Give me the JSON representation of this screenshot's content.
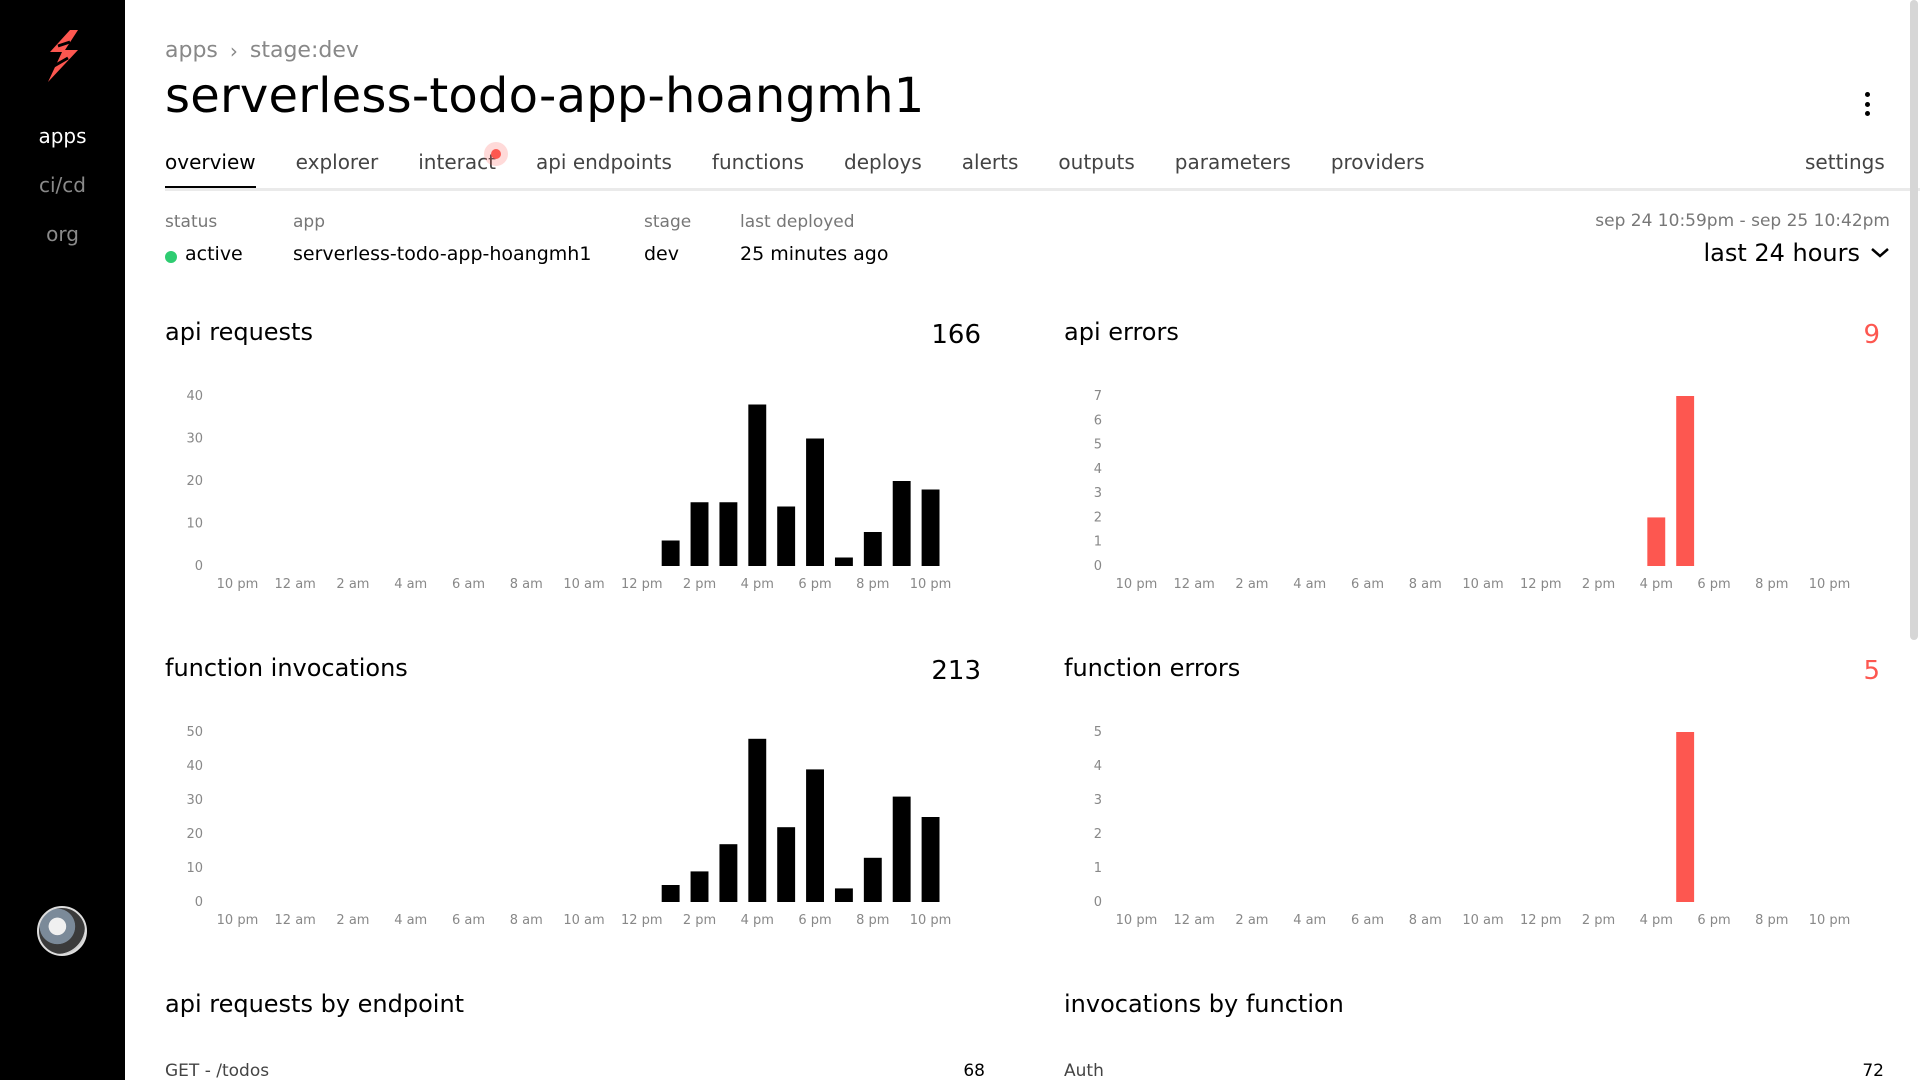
{
  "rail": {
    "items": [
      {
        "label": "apps",
        "active": true
      },
      {
        "label": "ci/cd",
        "active": false
      },
      {
        "label": "org",
        "active": false
      }
    ]
  },
  "breadcrumb": {
    "root": "apps",
    "current": "stage:dev"
  },
  "title": "serverless-todo-app-hoangmh1",
  "tabs": [
    {
      "label": "overview",
      "active": true
    },
    {
      "label": "explorer"
    },
    {
      "label": "interact",
      "notification": true
    },
    {
      "label": "api endpoints"
    },
    {
      "label": "functions"
    },
    {
      "label": "deploys"
    },
    {
      "label": "alerts"
    },
    {
      "label": "outputs"
    },
    {
      "label": "parameters"
    },
    {
      "label": "providers"
    }
  ],
  "settings_label": "settings",
  "meta": {
    "status_label": "status",
    "status_value": "active",
    "app_label": "app",
    "app_value": "serverless-todo-app-hoangmh1",
    "stage_label": "stage",
    "stage_value": "dev",
    "deployed_label": "last deployed",
    "deployed_value": "25 minutes ago"
  },
  "range": {
    "dates": "sep 24 10:59pm - sep 25 10:42pm",
    "selected": "last 24 hours"
  },
  "colors": {
    "black_bar": "#000000",
    "error_bar": "#fd5750",
    "active_dot": "#2ecc71"
  },
  "chart_data": [
    {
      "type": "bar",
      "title": "api requests",
      "total": "166",
      "categories": [
        "10 pm",
        "11 pm",
        "12 am",
        "1 am",
        "2 am",
        "3 am",
        "4 am",
        "5 am",
        "6 am",
        "7 am",
        "8 am",
        "9 am",
        "10 am",
        "11 am",
        "12 pm",
        "1 pm",
        "2 pm",
        "3 pm",
        "4 pm",
        "5 pm",
        "6 pm",
        "7 pm",
        "8 pm",
        "9 pm",
        "10 pm"
      ],
      "values": [
        0,
        0,
        0,
        0,
        0,
        0,
        0,
        0,
        0,
        0,
        0,
        0,
        0,
        0,
        0,
        6,
        15,
        15,
        38,
        14,
        30,
        2,
        8,
        20,
        18
      ],
      "ylim": [
        0,
        40
      ],
      "yticks": [
        0,
        10,
        20,
        30,
        40
      ],
      "xticks": [
        "10 pm",
        "12 am",
        "2 am",
        "4 am",
        "6 am",
        "8 am",
        "10 am",
        "12 pm",
        "2 pm",
        "4 pm",
        "6 pm",
        "8 pm",
        "10 pm"
      ],
      "color": "#000000"
    },
    {
      "type": "bar",
      "title": "api errors",
      "total": "9",
      "categories": [
        "10 pm",
        "11 pm",
        "12 am",
        "1 am",
        "2 am",
        "3 am",
        "4 am",
        "5 am",
        "6 am",
        "7 am",
        "8 am",
        "9 am",
        "10 am",
        "11 am",
        "12 pm",
        "1 pm",
        "2 pm",
        "3 pm",
        "4 pm",
        "5 pm",
        "6 pm",
        "7 pm",
        "8 pm",
        "9 pm",
        "10 pm"
      ],
      "values": [
        0,
        0,
        0,
        0,
        0,
        0,
        0,
        0,
        0,
        0,
        0,
        0,
        0,
        0,
        0,
        0,
        0,
        0,
        2,
        7,
        0,
        0,
        0,
        0,
        0
      ],
      "ylim": [
        0,
        7
      ],
      "yticks": [
        0,
        1,
        2,
        3,
        4,
        5,
        6,
        7
      ],
      "xticks": [
        "10 pm",
        "12 am",
        "2 am",
        "4 am",
        "6 am",
        "8 am",
        "10 am",
        "12 pm",
        "2 pm",
        "4 pm",
        "6 pm",
        "8 pm",
        "10 pm"
      ],
      "color": "#fd5750"
    },
    {
      "type": "bar",
      "title": "function invocations",
      "total": "213",
      "categories": [
        "10 pm",
        "11 pm",
        "12 am",
        "1 am",
        "2 am",
        "3 am",
        "4 am",
        "5 am",
        "6 am",
        "7 am",
        "8 am",
        "9 am",
        "10 am",
        "11 am",
        "12 pm",
        "1 pm",
        "2 pm",
        "3 pm",
        "4 pm",
        "5 pm",
        "6 pm",
        "7 pm",
        "8 pm",
        "9 pm",
        "10 pm"
      ],
      "values": [
        0,
        0,
        0,
        0,
        0,
        0,
        0,
        0,
        0,
        0,
        0,
        0,
        0,
        0,
        0,
        5,
        9,
        17,
        48,
        22,
        39,
        4,
        13,
        31,
        25
      ],
      "ylim": [
        0,
        50
      ],
      "yticks": [
        0,
        10,
        20,
        30,
        40,
        50
      ],
      "xticks": [
        "10 pm",
        "12 am",
        "2 am",
        "4 am",
        "6 am",
        "8 am",
        "10 am",
        "12 pm",
        "2 pm",
        "4 pm",
        "6 pm",
        "8 pm",
        "10 pm"
      ],
      "color": "#000000"
    },
    {
      "type": "bar",
      "title": "function errors",
      "total": "5",
      "categories": [
        "10 pm",
        "11 pm",
        "12 am",
        "1 am",
        "2 am",
        "3 am",
        "4 am",
        "5 am",
        "6 am",
        "7 am",
        "8 am",
        "9 am",
        "10 am",
        "11 am",
        "12 pm",
        "1 pm",
        "2 pm",
        "3 pm",
        "4 pm",
        "5 pm",
        "6 pm",
        "7 pm",
        "8 pm",
        "9 pm",
        "10 pm"
      ],
      "values": [
        0,
        0,
        0,
        0,
        0,
        0,
        0,
        0,
        0,
        0,
        0,
        0,
        0,
        0,
        0,
        0,
        0,
        0,
        0,
        5,
        0,
        0,
        0,
        0,
        0
      ],
      "ylim": [
        0,
        5
      ],
      "yticks": [
        0,
        1,
        2,
        3,
        4,
        5
      ],
      "xticks": [
        "10 pm",
        "12 am",
        "2 am",
        "4 am",
        "6 am",
        "8 am",
        "10 am",
        "12 pm",
        "2 pm",
        "4 pm",
        "6 pm",
        "8 pm",
        "10 pm"
      ],
      "color": "#fd5750"
    }
  ],
  "lists": {
    "endpoints": {
      "title": "api requests by endpoint",
      "rows": [
        {
          "name": "GET - /todos",
          "count": "68"
        }
      ]
    },
    "functions": {
      "title": "invocations by function",
      "rows": [
        {
          "name": "Auth",
          "count": "72"
        }
      ]
    }
  }
}
